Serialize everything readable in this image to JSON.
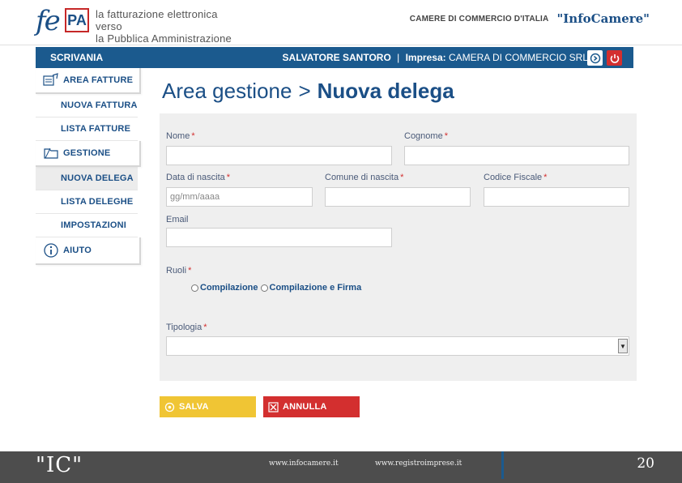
{
  "header": {
    "logo_fe": "fe",
    "logo_pa": "PA",
    "tagline_line1": "la fatturazione elettronica verso",
    "tagline_line2": "la Pubblica Amministrazione",
    "camere": "CAMERE DI COMMERCIO D'ITALIA",
    "infocamere": "\"InfoCamere\""
  },
  "topbar": {
    "section": "SCRIVANIA",
    "user": "SALVATORE SANTORO",
    "separator": "|",
    "company_label": "Impresa:",
    "company": "CAMERA DI COMMERCIO SRL"
  },
  "sidebar": {
    "area_fatture": "AREA FATTURE",
    "nuova_fattura": "NUOVA FATTURA",
    "lista_fatture": "LISTA FATTURE",
    "gestione": "GESTIONE",
    "nuova_delega": "NUOVA DELEGA",
    "lista_deleghe": "LISTA DELEGHE",
    "impostazioni": "IMPOSTAZIONI",
    "aiuto": "AIUTO"
  },
  "page": {
    "breadcrumb_parent": "Area gestione",
    "breadcrumb_sep": ">",
    "breadcrumb_current": "Nuova delega"
  },
  "form": {
    "required_mark": "*",
    "nome_label": "Nome",
    "cognome_label": "Cognome",
    "data_nascita_label": "Data di nascita",
    "data_nascita_placeholder": "gg/mm/aaaa",
    "comune_label": "Comune di nascita",
    "codice_fiscale_label": "Codice Fiscale",
    "email_label": "Email",
    "ruoli_label": "Ruoli",
    "ruolo_1": "Compilazione",
    "ruolo_2": "Compilazione e Firma",
    "tipologia_label": "Tipologia"
  },
  "actions": {
    "save": "SALVA",
    "cancel": "ANNULLA"
  },
  "footer": {
    "ic": "\"IC\"",
    "link1": "www.infocamere.it",
    "link2": "www.registroimprese.it",
    "page": "20"
  },
  "colors": {
    "brand_blue": "#1b5a8e",
    "save_yellow": "#f0c534",
    "cancel_red": "#d32f2f"
  }
}
